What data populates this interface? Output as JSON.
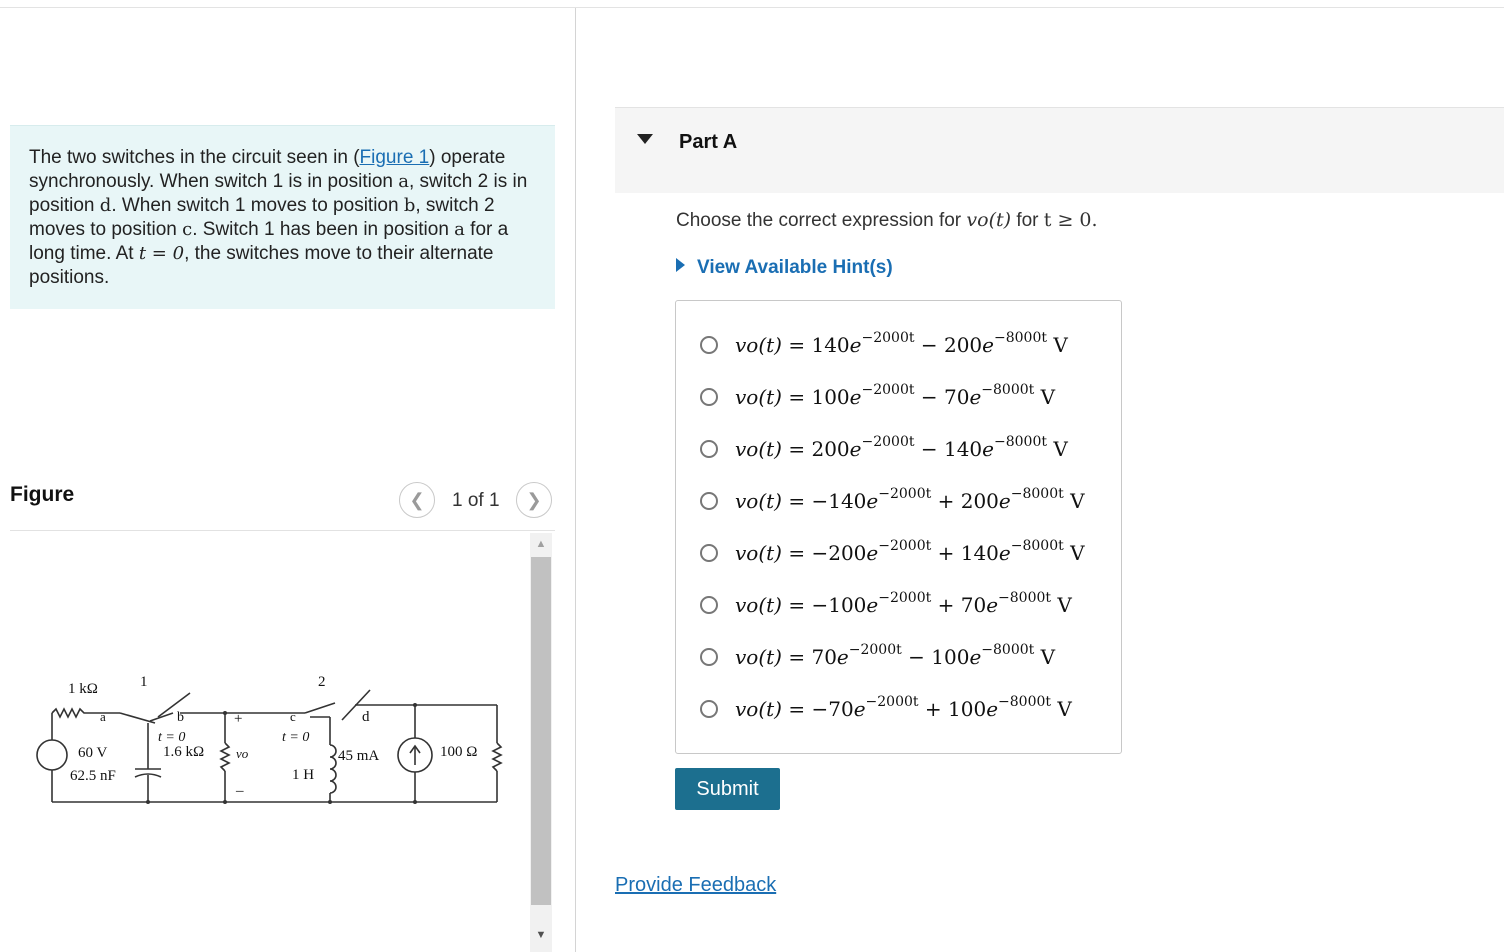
{
  "problem": {
    "text_1": "The two switches in the circuit seen in (",
    "figure_link": "Figure 1",
    "text_2": ") operate synchronously. When switch 1 is in position ",
    "pos_a": "a",
    "text_3": ", switch 2 is in position ",
    "pos_d": "d",
    "text_4": ". When switch 1 moves to position ",
    "pos_b": "b",
    "text_5": ", switch 2 moves to position ",
    "pos_c": "c",
    "text_6": ". Switch 1 has been in position ",
    "pos_a2": "a",
    "text_7": " for a long time. At ",
    "t_zero": "t = 0",
    "text_8": ", the switches move to their alternate positions."
  },
  "figure": {
    "title": "Figure",
    "pager": "1 of 1",
    "prev_icon": "chevron-left-icon",
    "next_icon": "chevron-right-icon",
    "labels": {
      "r1": "1 kΩ",
      "switch1": "1",
      "switch2": "2",
      "node_a": "a",
      "node_b": "b",
      "node_c": "c",
      "node_d": "d",
      "t0_left": "t = 0",
      "t0_right": "t = 0",
      "source": "60 V",
      "cap": "62.5 nF",
      "r2": "1.6 kΩ",
      "vo": "vo",
      "plus": "+",
      "minus": "–",
      "inductor": "1 H",
      "current": "45 mA",
      "r3": "100 Ω"
    }
  },
  "part": {
    "title": "Part A"
  },
  "question": {
    "prefix": "Choose the correct expression for ",
    "var": "vo(t)",
    "mid": " for ",
    "cond": "t ≥ 0."
  },
  "hint": {
    "label": "View Available Hint(s)"
  },
  "choices": [
    {
      "c1": "140",
      "e1": "−2000t",
      "op": "−",
      "c2": "200",
      "e2": "−8000t"
    },
    {
      "c1": "100",
      "e1": "−2000t",
      "op": "−",
      "c2": "70",
      "e2": "−8000t"
    },
    {
      "c1": "200",
      "e1": "−2000t",
      "op": "−",
      "c2": "140",
      "e2": "−8000t"
    },
    {
      "c1": "−140",
      "e1": "−2000t",
      "op": "+",
      "c2": "200",
      "e2": "−8000t"
    },
    {
      "c1": "−200",
      "e1": "−2000t",
      "op": "+",
      "c2": "140",
      "e2": "−8000t"
    },
    {
      "c1": "−100",
      "e1": "−2000t",
      "op": "+",
      "c2": "70",
      "e2": "−8000t"
    },
    {
      "c1": "70",
      "e1": "−2000t",
      "op": "−",
      "c2": "100",
      "e2": "−8000t"
    },
    {
      "c1": "−70",
      "e1": "−2000t",
      "op": "+",
      "c2": "100",
      "e2": "−8000t"
    }
  ],
  "expr_lhs": "vo(t) =",
  "expr_unit": "V",
  "submit": {
    "label": "Submit"
  },
  "feedback": {
    "label": "Provide Feedback"
  }
}
